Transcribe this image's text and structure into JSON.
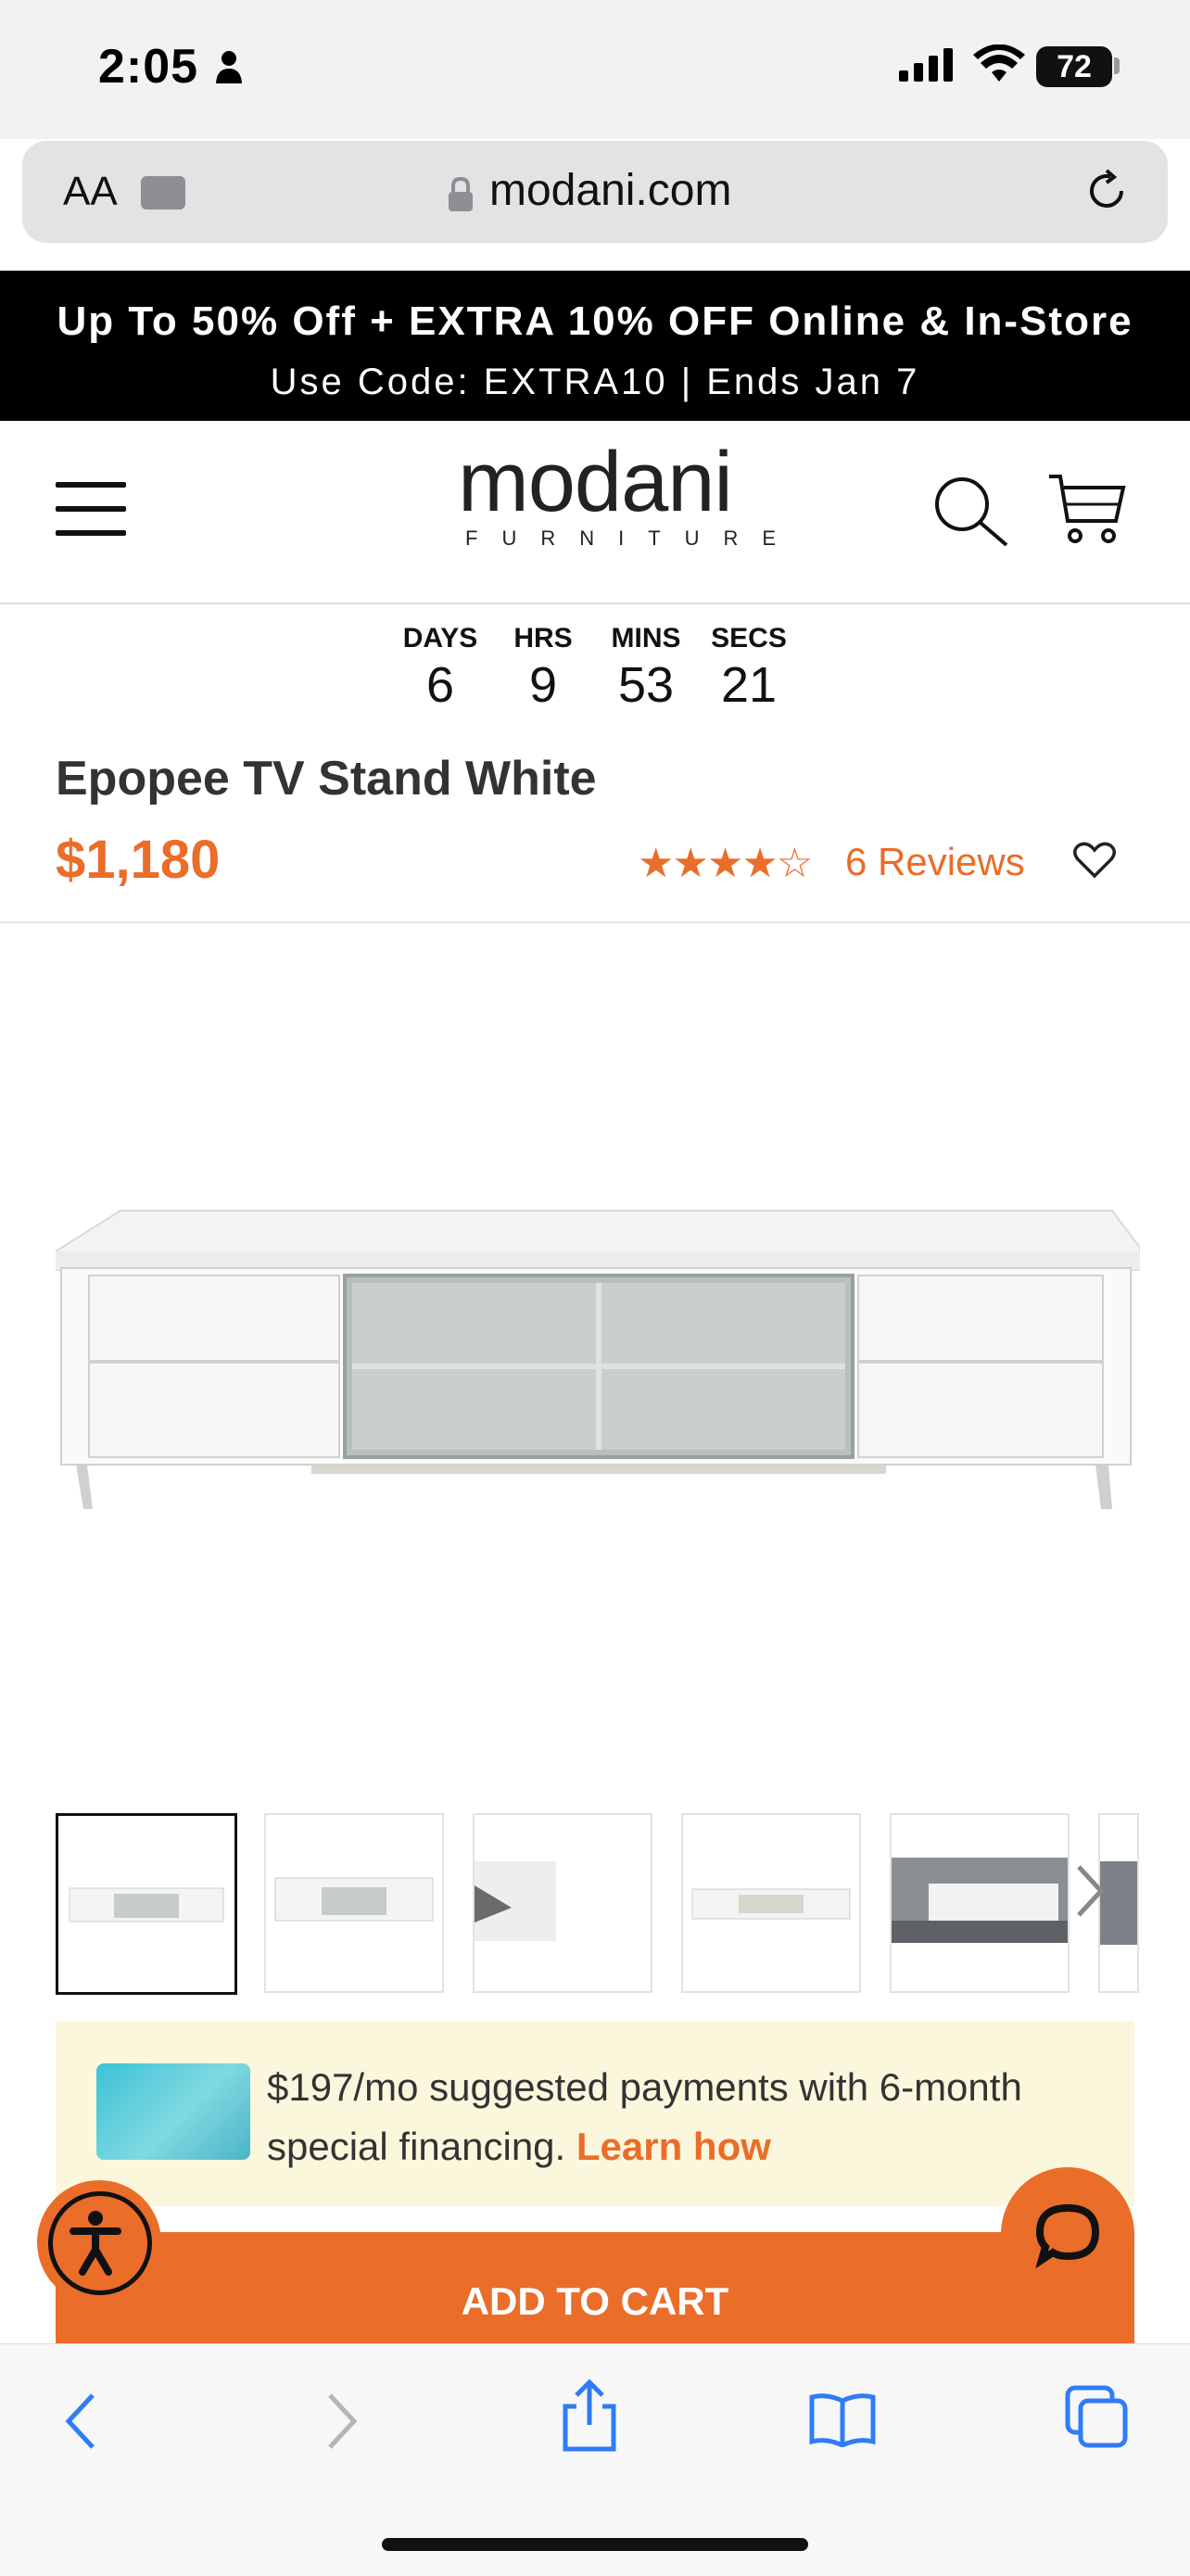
{
  "status_bar": {
    "time": "2:05",
    "battery": "72"
  },
  "browser": {
    "text_size_label": "AA",
    "url": "modani.com"
  },
  "promo": {
    "line1": "Up To 50% Off + EXTRA 10% OFF Online & In-Store",
    "line2": "Use Code: EXTRA10 | Ends Jan 7"
  },
  "header": {
    "logo_main": "modani",
    "logo_sub": "FURNITURE"
  },
  "countdown": [
    {
      "label": "DAYS",
      "value": "6"
    },
    {
      "label": "HRS",
      "value": "9"
    },
    {
      "label": "MINS",
      "value": "53"
    },
    {
      "label": "SECS",
      "value": "21"
    }
  ],
  "product": {
    "title": "Epopee TV Stand White",
    "price": "$1,180",
    "rating": {
      "stars_filled": 4,
      "stars_total": 5,
      "display": "★★★★☆"
    },
    "reviews_label": "6 Reviews"
  },
  "financing": {
    "text": "$197/mo suggested payments with 6-month special financing.",
    "link": "Learn how"
  },
  "actions": {
    "add_to_cart": "ADD TO CART"
  },
  "colors": {
    "accent": "#ea6d2a",
    "promo_bg": "#000000",
    "financing_bg": "#fbf7dd"
  }
}
